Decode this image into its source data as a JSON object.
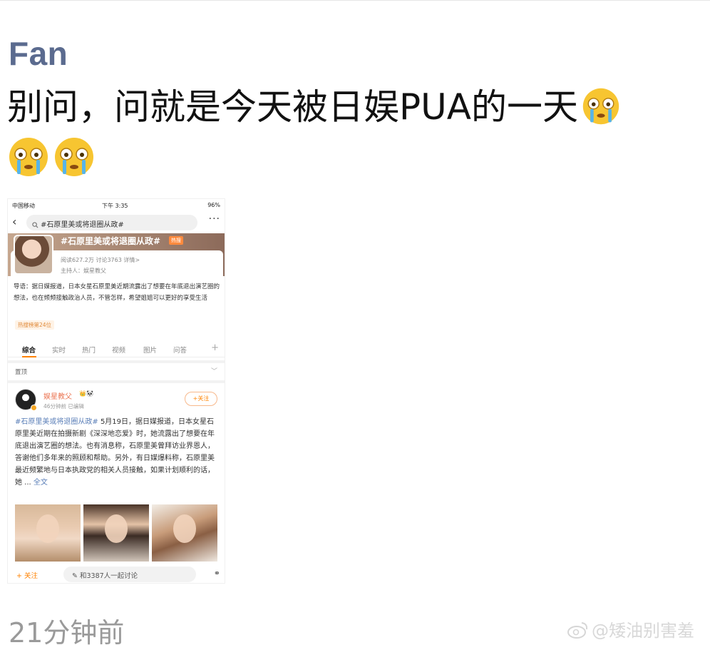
{
  "author": "Fan",
  "post_text": "别问，问就是今天被日娱PUA的一天",
  "emojis": [
    "crying-face-emoji",
    "crying-face-emoji",
    "crying-face-emoji"
  ],
  "timestamp": "21分钟前",
  "watermark": "@矮油别害羞",
  "screenshot": {
    "status": {
      "carrier": "中国移动",
      "time": "下午 3:35",
      "battery": "96%"
    },
    "search_query": "#石原里美或将退圈从政#",
    "more_label": "···",
    "topic": {
      "title": "#石原里美或将退圈从政#",
      "hot_badge": "热搜",
      "stats": "阅读627.2万  讨论3763  详情>",
      "host": "主持人：娱星教父",
      "intro": "导语：据日媒报道，日本女星石原里美近期流露出了想要在年底退出演艺圈的想法，也在频频接触政治人员，不管怎样，希望姐姐可以更好的享受生活",
      "rank": "热搜榜第24位"
    },
    "tabs": [
      "综合",
      "实时",
      "热门",
      "视频",
      "图片",
      "问答"
    ],
    "pinned_label": "置顶",
    "post": {
      "username": "娱星教父",
      "meta": "46分钟前  已编辑",
      "follow_label": "+关注",
      "hashtag": "#石原里美或将退圈从政#",
      "body": " 5月19日，据日媒报道，日本女星石原里美近期在拍摄新剧《深深地恋爱》时，她流露出了想要在年底退出演艺圈的想法。也有消息称，石原里美曾拜访业界恩人，答谢他们多年来的照顾和帮助。另外，有日媒爆料称，石原里美最近频繁地与日本执政党的相关人员接触，如果计划顺利的话，她 ... ",
      "full_text_link": "全文"
    },
    "bottom_bar": {
      "follow_label": "+ 关注",
      "comment_placeholder": "和3387人一起讨论"
    }
  }
}
